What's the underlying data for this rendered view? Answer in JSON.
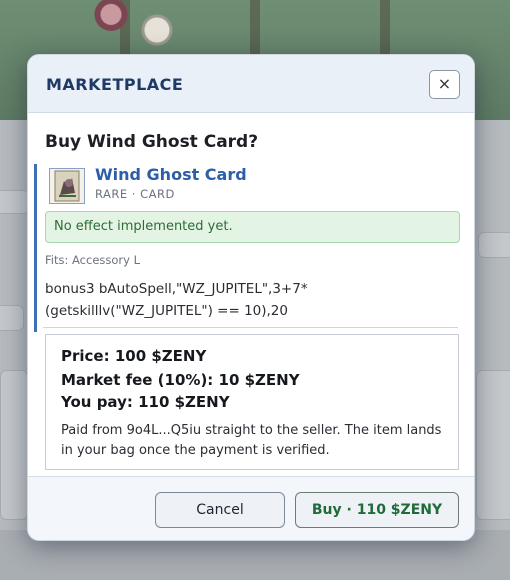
{
  "modal": {
    "title": "MARKETPLACE",
    "close_label": "×",
    "question": "Buy Wind Ghost Card?"
  },
  "item": {
    "name": "Wind Ghost Card",
    "meta": "RARE · CARD",
    "notice": "No effect implemented yet.",
    "fits": "Fits: Accessory L",
    "script_line1": "bonus3 bAutoSpell,\"WZ_JUPITEL\",3+7*",
    "script_line2": "(getskilllv(\"WZ_JUPITEL\") == 10),20"
  },
  "pricing": {
    "price": "Price: 100 $ZENY",
    "fee": "Market fee (10%): 10 $ZENY",
    "total": "You pay: 110 $ZENY",
    "note": "Paid from 9o4L...Q5iu straight to the seller. The item lands in your bag once the payment is verified."
  },
  "actions": {
    "cancel": "Cancel",
    "buy": "Buy · 110 $ZENY"
  },
  "colors": {
    "title": "#1f3a66",
    "item_name": "#2d5ea8",
    "notice_bg": "#e3f4e4",
    "notice_text": "#2f6b36",
    "buy_text": "#1f6b3a"
  },
  "icons": {
    "close": "close-icon",
    "card": "card-art-icon"
  }
}
